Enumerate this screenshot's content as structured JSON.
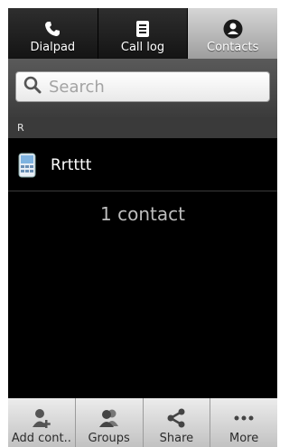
{
  "tabs": [
    {
      "label": "Dialpad",
      "icon": "phone-icon",
      "active": false
    },
    {
      "label": "Call log",
      "icon": "call-log-icon",
      "active": false
    },
    {
      "label": "Contacts",
      "icon": "contacts-icon",
      "active": true
    }
  ],
  "search": {
    "placeholder": "Search"
  },
  "section": {
    "letter": "R"
  },
  "contacts": [
    {
      "name": "Rrtttt",
      "icon": "mobile-phone-icon"
    }
  ],
  "summary": {
    "count_text": "1 contact"
  },
  "bottom_bar": [
    {
      "label": "Add cont..",
      "icon": "add-contact-icon"
    },
    {
      "label": "Groups",
      "icon": "groups-icon"
    },
    {
      "label": "Share",
      "icon": "share-icon"
    },
    {
      "label": "More",
      "icon": "more-icon"
    }
  ],
  "colors": {
    "background": "#000000",
    "active_tab": "#b9b9b9",
    "bottom_bar": "#d5d5d5"
  }
}
